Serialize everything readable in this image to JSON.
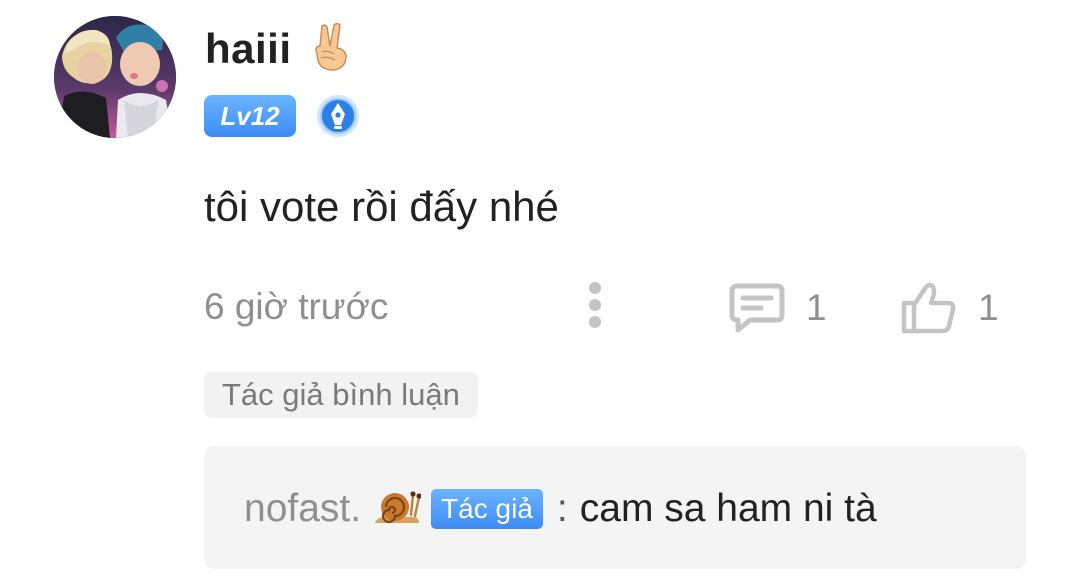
{
  "comment": {
    "username": "haiii",
    "username_emoji_icon": "victory-hand-icon",
    "level_badge": "Lv12",
    "medal_icon": "pen-medal-icon",
    "text": "tôi vote rồi đấy nhé",
    "timestamp": "6 giờ trước",
    "reply_count": "1",
    "like_count": "1",
    "icons": {
      "more": "vertical-dots-icon",
      "reply": "speech-bubble-icon",
      "like": "thumbs-up-icon"
    }
  },
  "author_reply": {
    "section_label": "Tác giả bình luận",
    "username": "nofast.",
    "username_emoji_icon": "snail-icon",
    "author_tag": "Tác giả",
    "separator": ":",
    "text": "cam sa ham ni tà"
  },
  "colors": {
    "badge_blue": "#4a9af8",
    "muted_text": "#8f8f8f",
    "main_text": "#222222",
    "reply_background": "#f4f4f4"
  }
}
